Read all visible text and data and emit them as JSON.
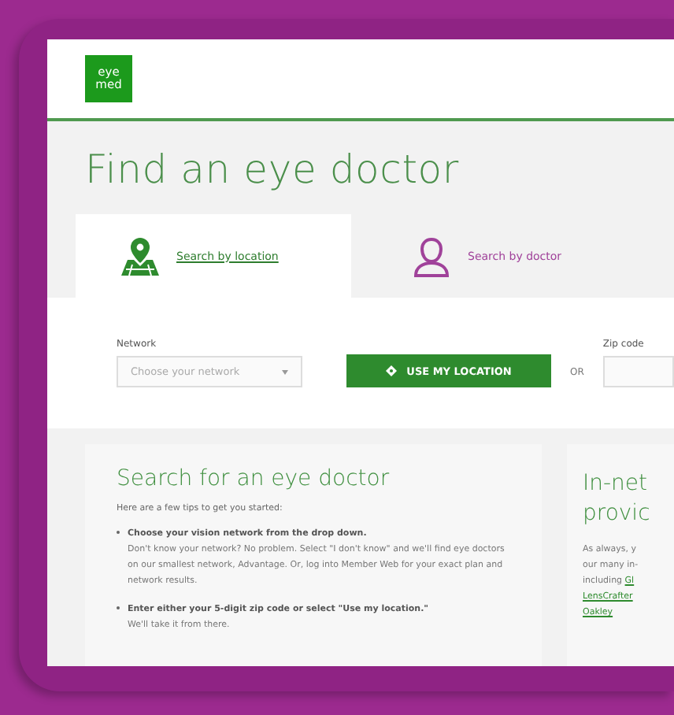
{
  "header": {
    "logo": "eye\nmed"
  },
  "title": "Find an eye doctor",
  "tabs": [
    {
      "label": "Search by location",
      "selected": true,
      "kind": "location"
    },
    {
      "label": "Search by doctor",
      "selected": false,
      "kind": "doctor"
    }
  ],
  "form": {
    "network_label": "Network",
    "network_placeholder": "Choose your network",
    "location_button": "USE MY LOCATION",
    "or": "OR",
    "zip_label": "Zip code"
  },
  "tips_card": {
    "title": "Search for an eye doctor",
    "intro": "Here are a few tips to get you started:",
    "bullets": [
      {
        "lead": "Choose your vision network from the drop down.",
        "text": "Don't know your network? No problem. Select \"I don't know\" and we'll find eye doctors on our smallest network, Advantage. Or, log into Member Web for your exact plan and network results."
      },
      {
        "lead": "Enter either your 5-digit zip code or select \"Use my location.\"",
        "text": "We'll take it from there."
      }
    ]
  },
  "providers_card": {
    "title_lines": [
      "In-net",
      "provic"
    ],
    "lines": [
      [
        {
          "text": "As always, y",
          "link": false
        }
      ],
      [
        {
          "text": "our many in-",
          "link": false
        }
      ],
      [
        {
          "text": "including ",
          "link": false
        },
        {
          "text": "Gl",
          "link": true
        }
      ],
      [
        {
          "text": "LensCrafter",
          "link": true
        }
      ],
      [
        {
          "text": "Oakley",
          "link": true
        }
      ]
    ]
  }
}
